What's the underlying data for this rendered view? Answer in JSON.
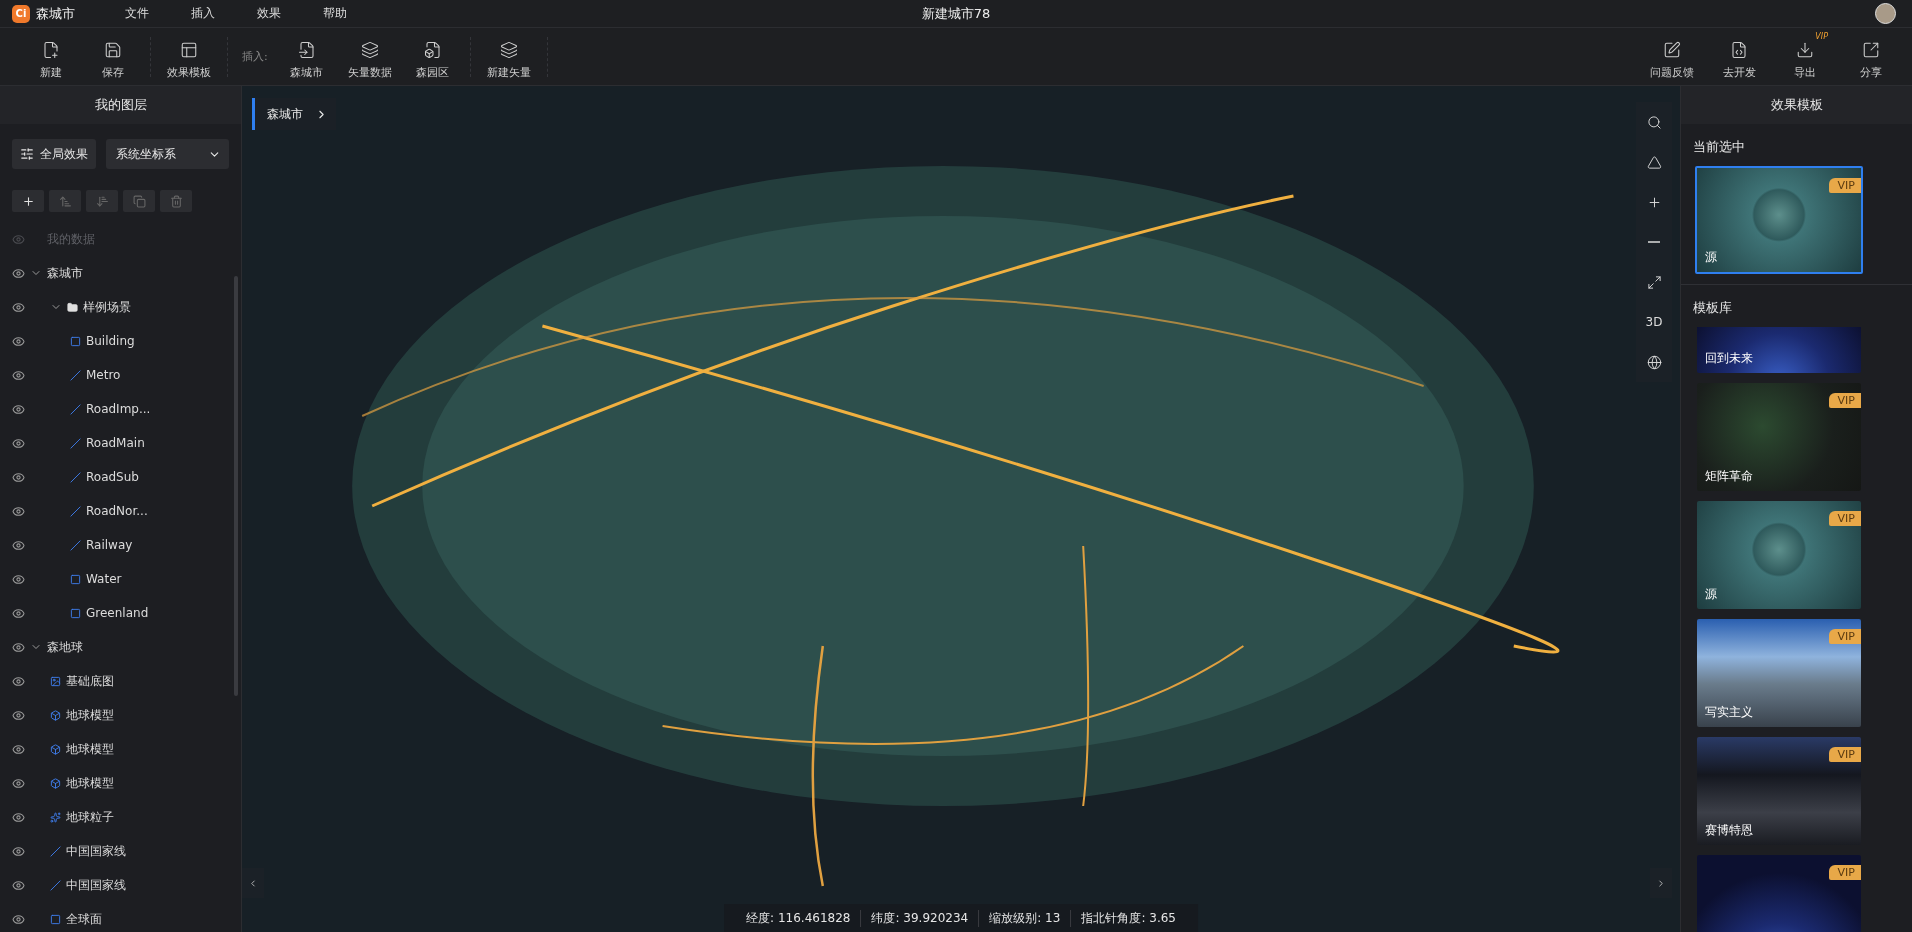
{
  "app": {
    "name": "森城市",
    "logo": "Ci"
  },
  "menu": [
    "文件",
    "插入",
    "效果",
    "帮助"
  ],
  "title": "新建城市78",
  "toolbar": {
    "groups": [
      {
        "items": [
          {
            "label": "新建",
            "kind": "new"
          },
          {
            "label": "保存",
            "kind": "save"
          }
        ]
      },
      {
        "items": [
          {
            "label": "效果模板",
            "kind": "template"
          }
        ]
      },
      {
        "label": "插入:",
        "items": [
          {
            "label": "森城市",
            "kind": "city"
          },
          {
            "label": "矢量数据",
            "kind": "vector"
          },
          {
            "label": "森园区",
            "kind": "park"
          }
        ]
      },
      {
        "items": [
          {
            "label": "新建矢量",
            "kind": "new-vector"
          }
        ]
      }
    ],
    "right": [
      {
        "label": "问题反馈",
        "kind": "feedback"
      },
      {
        "label": "去开发",
        "kind": "code"
      },
      {
        "label": "导出",
        "kind": "export",
        "badge": "VIP"
      },
      {
        "label": "分享",
        "kind": "share"
      }
    ]
  },
  "layers": {
    "title": "我的图层",
    "global_button": "全局效果",
    "coordinate_select": "系统坐标系",
    "actions": [
      {
        "kind": "add",
        "disabled": false
      },
      {
        "kind": "up",
        "disabled": true
      },
      {
        "kind": "down",
        "disabled": true
      },
      {
        "kind": "copy",
        "disabled": true
      },
      {
        "kind": "delete",
        "disabled": true
      }
    ],
    "tree": [
      {
        "label": "我的数据",
        "kind": "data",
        "disabled": true
      },
      {
        "label": "森城市",
        "kind": "group",
        "disabled": false,
        "expanded": true,
        "children": [
          {
            "label": "样例场景",
            "kind": "folder",
            "disabled": false,
            "expanded": true,
            "children": [
              {
                "label": "Building",
                "kind": "polygon",
                "disabled": false
              },
              {
                "label": "Metro",
                "kind": "line",
                "disabled": false
              },
              {
                "label": "RoadImp...",
                "kind": "line",
                "disabled": false
              },
              {
                "label": "RoadMain",
                "kind": "line",
                "disabled": false
              },
              {
                "label": "RoadSub",
                "kind": "line",
                "disabled": false
              },
              {
                "label": "RoadNor...",
                "kind": "line",
                "disabled": false
              },
              {
                "label": "Railway",
                "kind": "line",
                "disabled": false
              },
              {
                "label": "Water",
                "kind": "polygon",
                "disabled": false
              },
              {
                "label": "Greenland",
                "kind": "polygon",
                "disabled": false
              }
            ]
          }
        ]
      },
      {
        "label": "森地球",
        "kind": "group",
        "disabled": false,
        "expanded": true,
        "children": [
          {
            "label": "基础底图",
            "kind": "basemap",
            "disabled": false
          },
          {
            "label": "地球模型",
            "kind": "model",
            "disabled": false
          },
          {
            "label": "地球模型",
            "kind": "model",
            "disabled": false
          },
          {
            "label": "地球模型",
            "kind": "model",
            "disabled": false
          },
          {
            "label": "地球粒子",
            "kind": "particles",
            "disabled": false
          },
          {
            "label": "中国国家线",
            "kind": "line",
            "disabled": false
          },
          {
            "label": "中国国家线",
            "kind": "line",
            "disabled": false
          },
          {
            "label": "全球面",
            "kind": "polygon",
            "disabled": false
          }
        ]
      }
    ]
  },
  "map": {
    "breadcrumb": "森城市",
    "controls": [
      {
        "kind": "search"
      },
      {
        "kind": "compass"
      },
      {
        "kind": "zoom-in"
      },
      {
        "kind": "zoom-out"
      },
      {
        "kind": "fullscreen"
      },
      {
        "kind": "text",
        "label": "3D"
      },
      {
        "kind": "globe"
      }
    ],
    "status": [
      {
        "label": "经度:",
        "value": "116.461828"
      },
      {
        "label": "纬度:",
        "value": "39.920234"
      },
      {
        "label": "缩放级别:",
        "value": "13"
      },
      {
        "label": "指北针角度:",
        "value": "3.65"
      }
    ]
  },
  "templates": {
    "title": "效果模板",
    "current_label": "当前选中",
    "current": {
      "name": "源",
      "kind": "globe",
      "badge": "VIP"
    },
    "library_label": "模板库",
    "library": [
      {
        "name": "回到未来",
        "kind": "earth-night"
      },
      {
        "name": "矩阵革命",
        "kind": "matrix",
        "badge": "VIP"
      },
      {
        "name": "源",
        "kind": "globe",
        "badge": "VIP"
      },
      {
        "name": "写实主义",
        "kind": "city-day",
        "badge": "VIP"
      },
      {
        "name": "赛博特恩",
        "kind": "city-night",
        "badge": "VIP"
      },
      {
        "kind": "earth-night",
        "badge": "VIP"
      }
    ]
  }
}
